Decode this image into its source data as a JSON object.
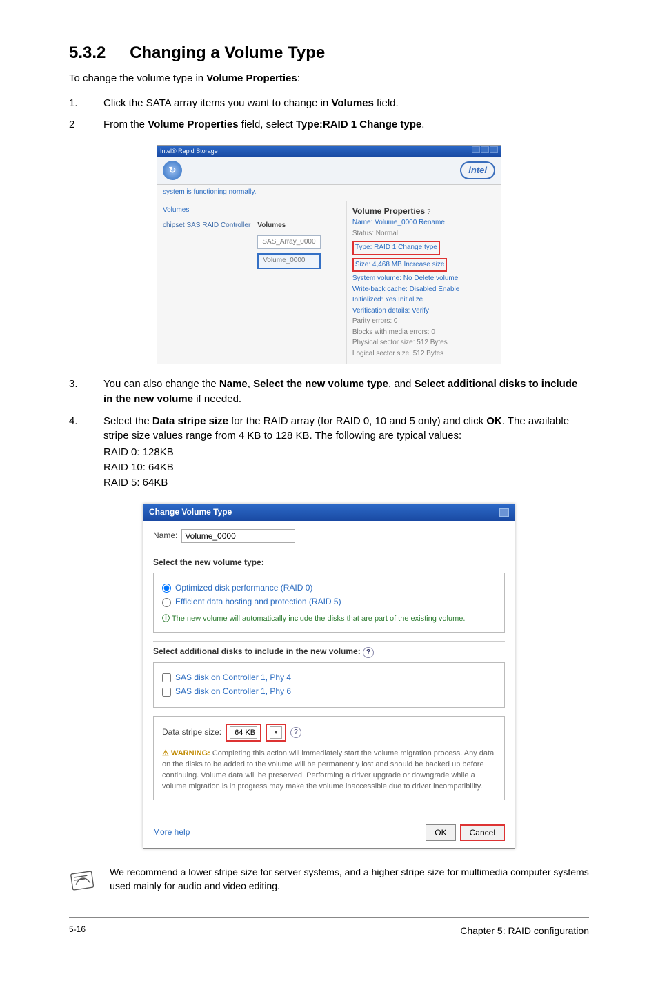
{
  "heading": {
    "number": "5.3.2",
    "title": "Changing a Volume Type"
  },
  "intro": {
    "before": "To change the volume type in ",
    "bold": "Volume Properties",
    "after": ":"
  },
  "steps": {
    "s1": {
      "num": "1.",
      "t1": "Click the SATA array items you want to change in ",
      "b1": "Volumes",
      "t2": " field."
    },
    "s2": {
      "num": "2",
      "t1": "From the ",
      "b1": "Volume Properties",
      "t2": " field, select ",
      "b2": "Type:RAID 1 Change type",
      "t3": "."
    },
    "s3": {
      "num": "3.",
      "t1": "You can also change the ",
      "b1": "Name",
      "t2": ", ",
      "b2": "Select the new volume type",
      "t3": ", and ",
      "b3": "Select additional disks to include in the new volume",
      "t4": " if needed."
    },
    "s4": {
      "num": "4.",
      "t1": "Select the ",
      "b1": "Data stripe size",
      "t2": " for the RAID array (for RAID 0, 10 and 5 only) and click ",
      "b2": "OK",
      "t3": ". The available stripe size values range from 4 KB to 128 KB. The following are typical values:",
      "v1": "RAID 0: 128KB",
      "v2": "RAID 10: 64KB",
      "v3": "RAID 5: 64KB"
    }
  },
  "shot1": {
    "titlebar": "Intel® Rapid Storage",
    "statusline": "system is functioning normally.",
    "tree_volumes": "Volumes",
    "controller": "chipset SAS RAID Controller",
    "volumes_label": "Volumes",
    "chip_array": "SAS_Array_0000",
    "chip_volume": "Volume_0000",
    "logo_text": "intel",
    "r_title": "Volume Properties",
    "r_name": "Name: Volume_0000 Rename",
    "r_status": "Status: Normal",
    "r_type": "Type: RAID 1 Change type",
    "r_size": "Size: 4,468 MB Increase size",
    "r_sys": "System volume: No Delete volume",
    "r_wb": "Write-back cache: Disabled Enable",
    "r_init": "Initialized: Yes Initialize",
    "r_verif": "Verification details: Verify",
    "r_parity": "Parity errors: 0",
    "r_blocks": "Blocks with media errors: 0",
    "r_phys": "Physical sector size: 512 Bytes",
    "r_log": "Logical sector size: 512 Bytes"
  },
  "shot2": {
    "title": "Change Volume Type",
    "name_label": "Name:",
    "name_value": "Volume_0000",
    "sec1": "Select the new volume type:",
    "opt1": "Optimized disk performance (RAID 0)",
    "opt2": "Efficient data hosting and protection (RAID 5)",
    "hint": "The new volume will automatically include the disks that are part of the existing volume.",
    "sec2": "Select additional disks to include in the new volume:",
    "chk1": "SAS disk on Controller 1, Phy 4",
    "chk2": "SAS disk on Controller 1, Phy 6",
    "stripe_label": "Data stripe size:",
    "stripe_value": "64 KB",
    "warning_prefix": "WARNING:",
    "warning_body": " Completing this action will immediately start the volume migration process. Any data on the disks to be added to the volume will be permanently lost and should be backed up before continuing. Volume data will be preserved. Performing a driver upgrade or downgrade while a volume migration is in progress may make the volume inaccessible due to driver incompatibility.",
    "more_help": "More help",
    "ok": "OK",
    "cancel": "Cancel"
  },
  "note": "We recommend a lower stripe size for server systems, and a higher stripe size for multimedia computer systems used mainly for audio and video editing.",
  "footer": {
    "page": "5-16",
    "chapter": "Chapter 5: RAID configuration"
  }
}
